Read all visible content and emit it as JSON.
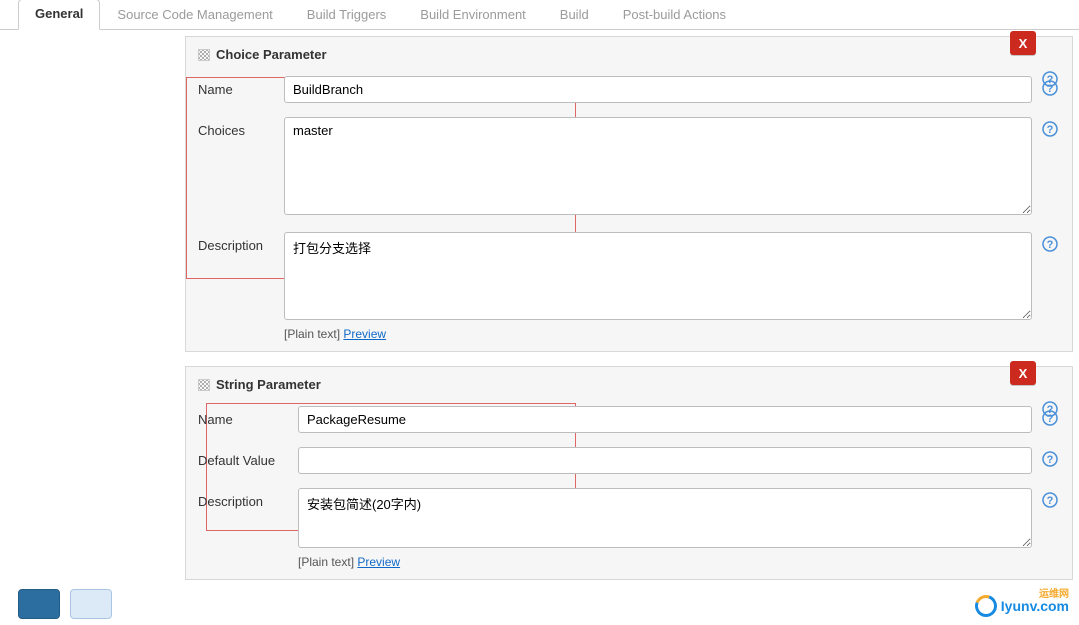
{
  "tabs": {
    "general": "General",
    "scm": "Source Code Management",
    "triggers": "Build Triggers",
    "env": "Build Environment",
    "build": "Build",
    "post": "Post-build Actions"
  },
  "param1": {
    "title": "Choice Parameter",
    "delete": "X",
    "name_label": "Name",
    "name_value": "BuildBranch",
    "choices_label": "Choices",
    "choices_value": "master",
    "desc_label": "Description",
    "desc_value": "打包分支选择",
    "format_prefix": "[Plain text]",
    "preview": "Preview"
  },
  "param2": {
    "title": "String Parameter",
    "delete": "X",
    "name_label": "Name",
    "name_value": "PackageResume",
    "default_label": "Default Value",
    "default_value": "",
    "desc_label": "Description",
    "desc_value": "安装包简述(20字内)",
    "format_prefix": "[Plain text]",
    "preview": "Preview"
  },
  "buttons": {
    "save": " ",
    "apply": " "
  },
  "watermark": {
    "text": "Iyunv.com",
    "small": "运维网"
  }
}
